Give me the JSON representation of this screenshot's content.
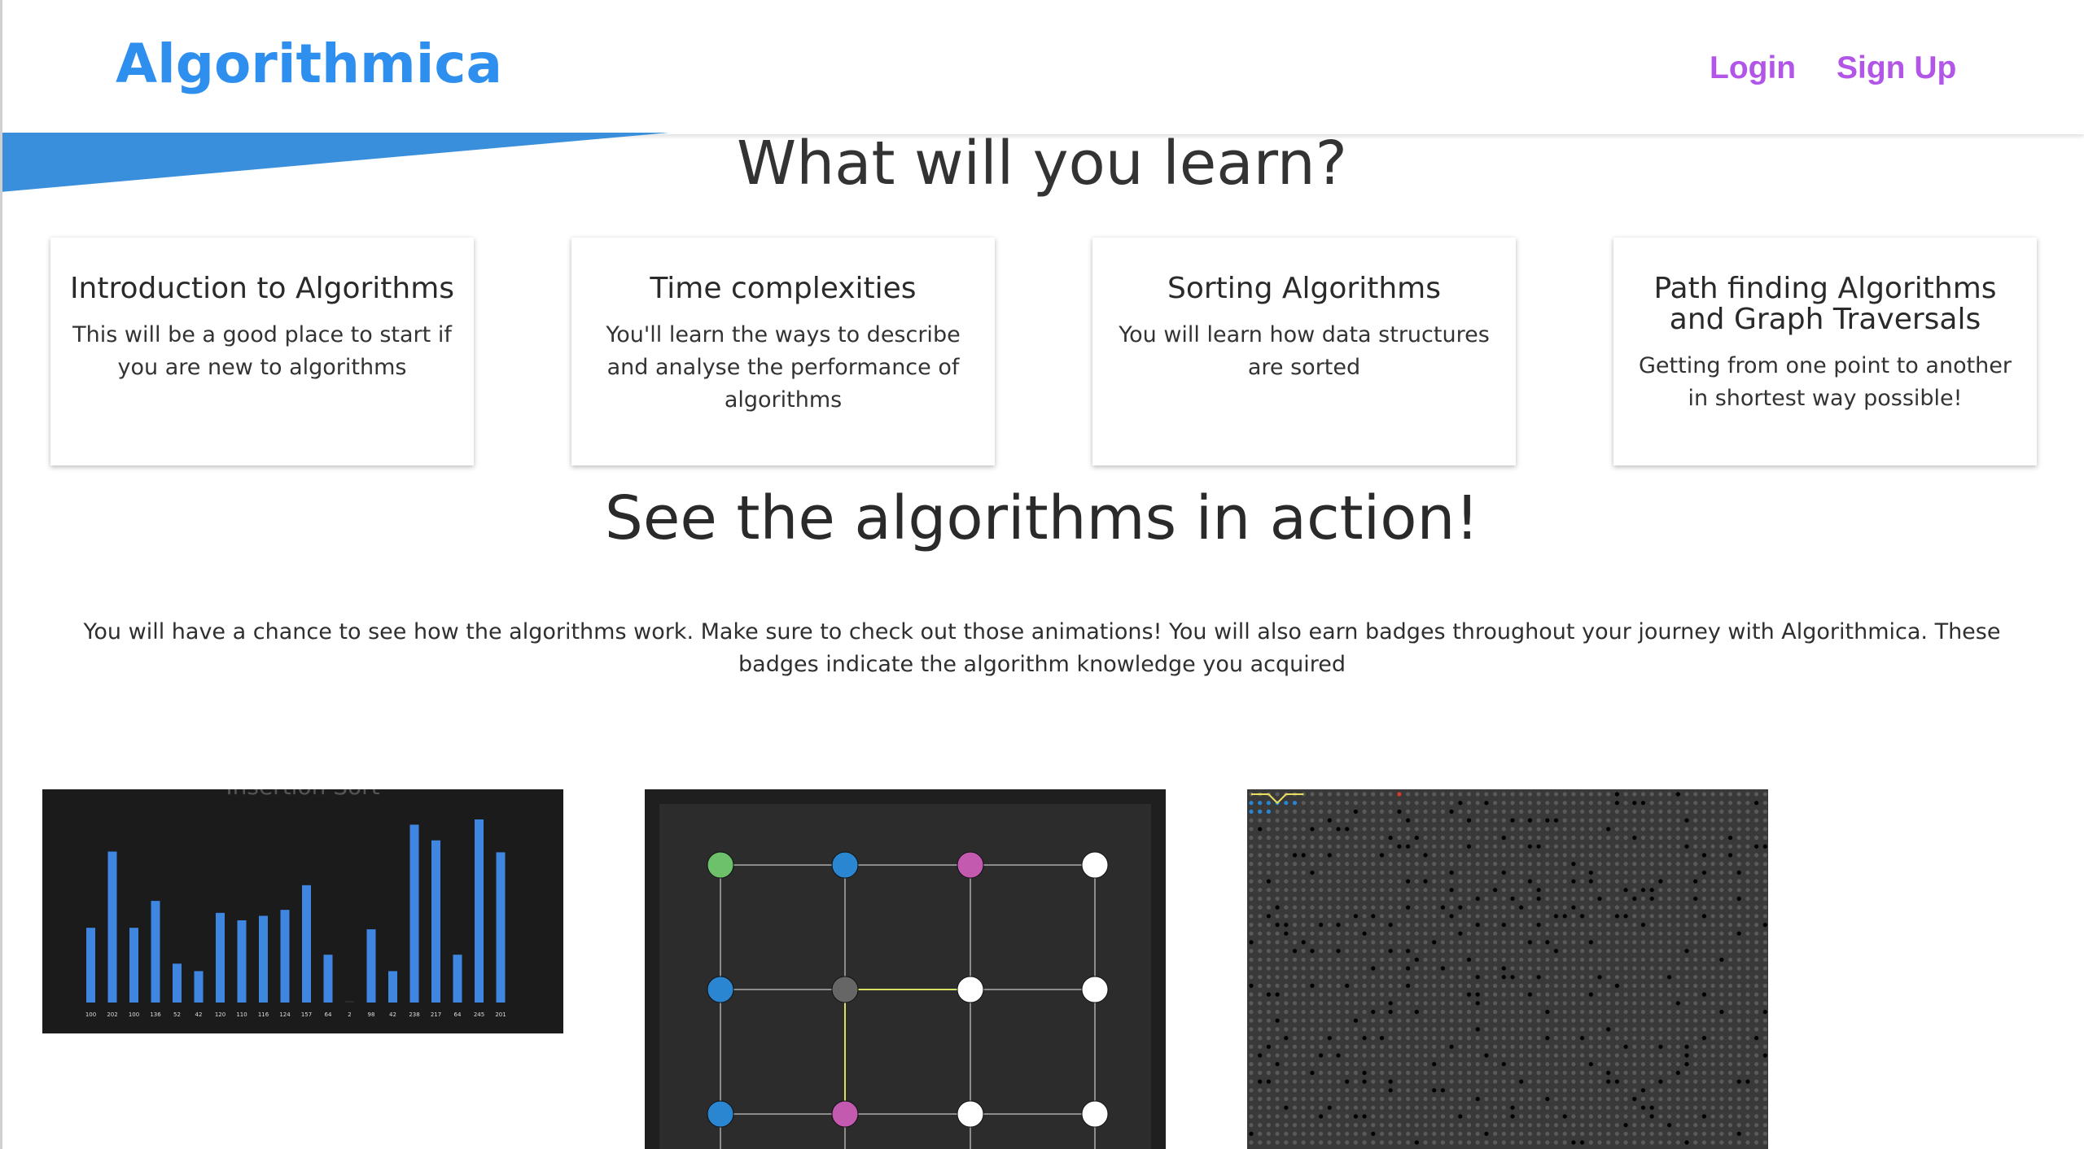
{
  "header": {
    "logo": "Algorithmica",
    "login": "Login",
    "signup": "Sign Up"
  },
  "learn": {
    "heading": "What will you learn?",
    "cards": [
      {
        "title": "Introduction to Algorithms",
        "text": "This will be a good place to start if you are new to algorithms"
      },
      {
        "title": "Time complexities",
        "text": "You'll learn the ways to describe and analyse the performance of algorithms"
      },
      {
        "title": "Sorting Algorithms",
        "text": "You will learn how data structures are sorted"
      },
      {
        "title": "Path finding Algorithms and Graph Traversals",
        "text": "Getting from one point to another in shortest way possible!"
      }
    ]
  },
  "action": {
    "heading": "See the algorithms in action!",
    "description": "You will have a chance to see how the algorithms work. Make sure to check out those animations! You will also earn badges throughout your journey with Algorithmica. These badges indicate the algorithm knowledge you acquired"
  },
  "previews": {
    "sort": {
      "title": "Insertion Sort",
      "values": [
        100,
        202,
        100,
        136,
        52,
        42,
        120,
        110,
        116,
        124,
        157,
        64,
        2,
        98,
        42,
        238,
        217,
        64,
        245,
        201
      ],
      "bar_color": "#3f86e0"
    },
    "graph": {
      "rows": [
        [
          "#6cc16a",
          "#2a86d0",
          "#c459b0",
          "#ffffff"
        ],
        [
          "#2a86d0",
          "#666666",
          "#ffffff",
          "#ffffff"
        ],
        [
          "#2a86d0",
          "#c459b0",
          "#ffffff",
          "#ffffff"
        ]
      ],
      "highlight_color": "#d8e063"
    },
    "grid": {
      "dot_color": "#5a5a5a",
      "wall_color": "#000000",
      "path_color": "#e8e05a",
      "visited_color": "#2a86d0",
      "target_color": "#d63a2a"
    }
  },
  "colors": {
    "brand": "#2f8fef",
    "nav_link": "#b256e8"
  }
}
